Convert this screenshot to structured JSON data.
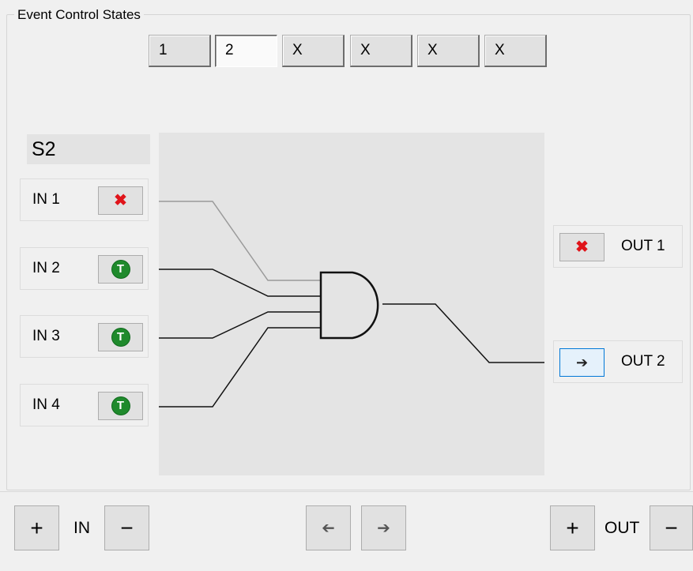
{
  "group": {
    "title": "Event Control States"
  },
  "state_tabs": [
    {
      "label": "1"
    },
    {
      "label": "2"
    },
    {
      "label": "X"
    },
    {
      "label": "X"
    },
    {
      "label": "X"
    },
    {
      "label": "X"
    }
  ],
  "selected_state_index": 1,
  "state_name": "S2",
  "inputs": [
    {
      "label": "IN 1",
      "icon": "x-icon",
      "symbol": "✖"
    },
    {
      "label": "IN 2",
      "icon": "trigger-icon",
      "symbol": "T"
    },
    {
      "label": "IN 3",
      "icon": "trigger-icon",
      "symbol": "T"
    },
    {
      "label": "IN 4",
      "icon": "trigger-icon",
      "symbol": "T"
    }
  ],
  "outputs": [
    {
      "label": "OUT 1",
      "icon": "x-icon",
      "symbol": "✖"
    },
    {
      "label": "OUT 2",
      "icon": "arrow-right-icon",
      "symbol": "➔"
    }
  ],
  "footer": {
    "add_in": "+",
    "in_label": "IN",
    "remove_in": "−",
    "prev_symbol": "➔",
    "next_symbol": "➔",
    "add_out": "+",
    "out_label": "OUT",
    "remove_out": "−"
  },
  "colors": {
    "x_icon": "#e0141a",
    "trigger_icon": "#1f8a2c",
    "focus_border": "#0078d7"
  }
}
